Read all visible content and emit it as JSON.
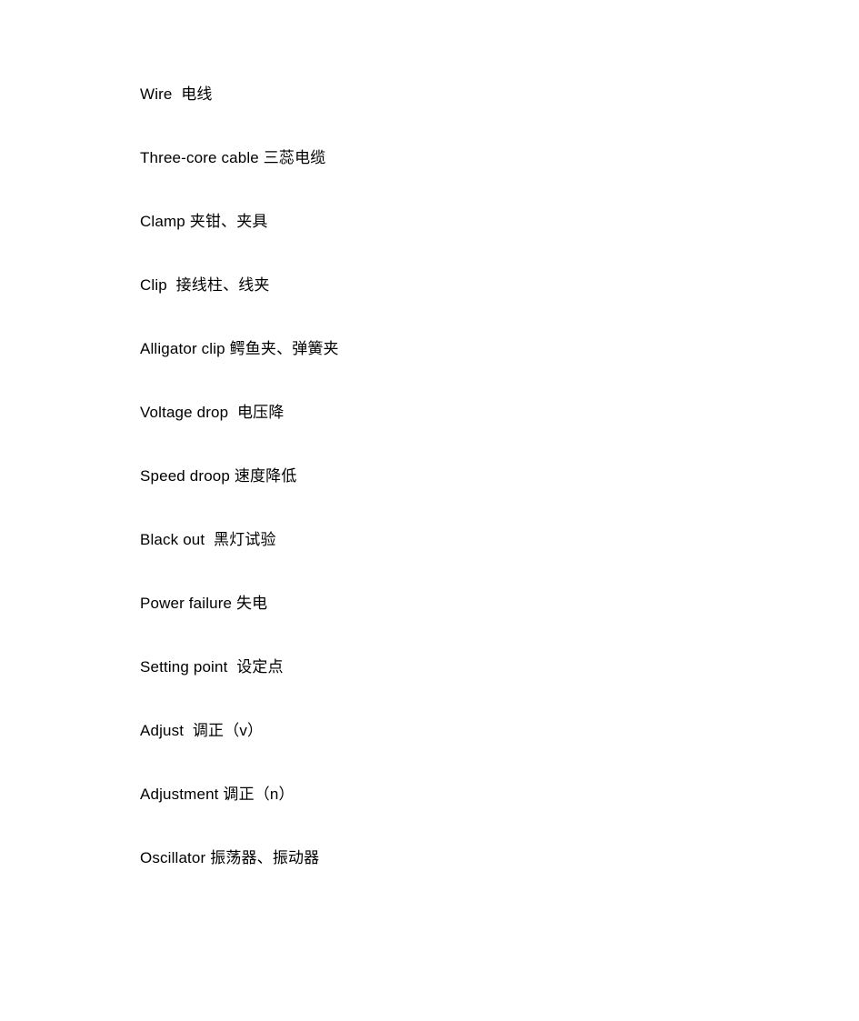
{
  "document": {
    "background_color": "#ffffff",
    "text_color": "#000000",
    "lines": [
      {
        "text": "Wire  电线"
      },
      {
        "text": "Three-core cable 三蕊电缆"
      },
      {
        "text": "Clamp 夹钳、夹具"
      },
      {
        "text": "Clip  接线柱、线夹"
      },
      {
        "text": "Alligator clip 鳄鱼夹、弹簧夹"
      },
      {
        "text": "Voltage drop  电压降"
      },
      {
        "text": "Speed droop 速度降低"
      },
      {
        "text": "Black out  黑灯试验"
      },
      {
        "text": "Power failure 失电"
      },
      {
        "text": "Setting point  设定点"
      },
      {
        "text": "Adjust  调正（v）"
      },
      {
        "text": "Adjustment 调正（n）"
      },
      {
        "text": "Oscillator 振荡器、振动器"
      }
    ]
  }
}
